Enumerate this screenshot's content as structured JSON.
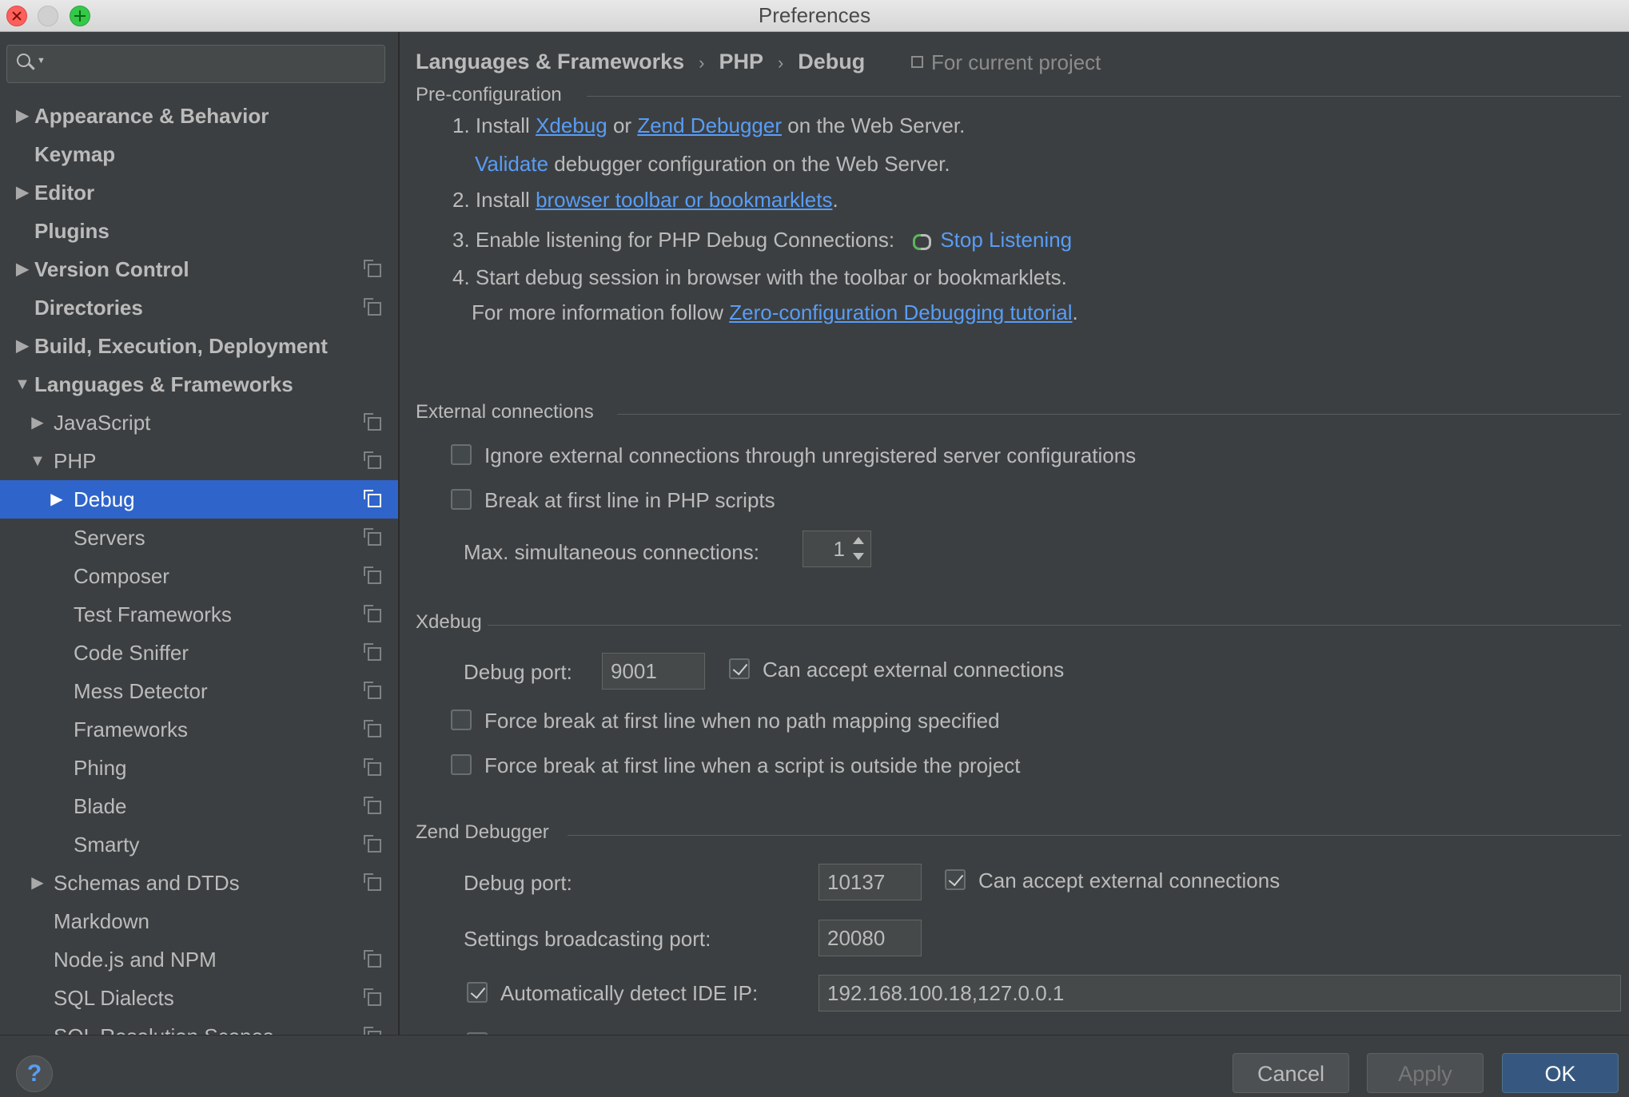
{
  "window": {
    "title": "Preferences"
  },
  "search": {
    "placeholder": ""
  },
  "sidebar": {
    "items": [
      {
        "label": "Appearance & Behavior"
      },
      {
        "label": "Keymap"
      },
      {
        "label": "Editor"
      },
      {
        "label": "Plugins"
      },
      {
        "label": "Version Control"
      },
      {
        "label": "Directories"
      },
      {
        "label": "Build, Execution, Deployment"
      },
      {
        "label": "Languages & Frameworks"
      },
      {
        "label": "JavaScript"
      },
      {
        "label": "PHP"
      },
      {
        "label": "Debug"
      },
      {
        "label": "Servers"
      },
      {
        "label": "Composer"
      },
      {
        "label": "Test Frameworks"
      },
      {
        "label": "Code Sniffer"
      },
      {
        "label": "Mess Detector"
      },
      {
        "label": "Frameworks"
      },
      {
        "label": "Phing"
      },
      {
        "label": "Blade"
      },
      {
        "label": "Smarty"
      },
      {
        "label": "Schemas and DTDs"
      },
      {
        "label": "Markdown"
      },
      {
        "label": "Node.js and NPM"
      },
      {
        "label": "SQL Dialects"
      },
      {
        "label": "SQL Resolution Scopes"
      }
    ]
  },
  "breadcrumb": {
    "items": [
      "Languages & Frameworks",
      "PHP",
      "Debug"
    ],
    "separator": "›",
    "scope_note": "For current project"
  },
  "preconfig": {
    "title": "Pre-configuration",
    "step1_prefix": "1. Install",
    "xdebug_link": "Xdebug",
    "or_text": "or",
    "zend_link": "Zend Debugger",
    "step1_suffix": "on the Web Server.",
    "validate_link": "Validate",
    "validate_suffix": "debugger configuration on the Web Server.",
    "step2_prefix": "2. Install",
    "toolbar_link": "browser toolbar or bookmarklets",
    "period": ".",
    "step3_text": "3. Enable listening for PHP Debug Connections:",
    "stop_listening": "Stop Listening",
    "step4_text": "4. Start debug session in browser with the toolbar or bookmarklets.",
    "more_info_prefix": "For more information follow",
    "tutorial_link": "Zero-configuration Debugging tutorial"
  },
  "external": {
    "title": "External connections",
    "ignore_label": "Ignore external connections through unregistered server configurations",
    "ignore_checked": false,
    "break_label": "Break at first line in PHP scripts",
    "break_checked": false,
    "max_label": "Max. simultaneous connections:",
    "max_value": "1"
  },
  "xdebug": {
    "title": "Xdebug",
    "port_label": "Debug port:",
    "port_value": "9001",
    "accept_label": "Can accept external connections",
    "accept_checked": true,
    "force_no_mapping_label": "Force break at first line when no path mapping specified",
    "force_outside_label": "Force break at first line when a script is outside the project"
  },
  "zend": {
    "title": "Zend Debugger",
    "port_label": "Debug port:",
    "port_value": "10137",
    "accept_label": "Can accept external connections",
    "accept_checked": true,
    "broadcast_label": "Settings broadcasting port:",
    "broadcast_value": "20080",
    "autodetect_label": "Automatically detect IDE IP:",
    "autodetect_checked": true,
    "ip_value": "192.168.100.18,127.0.0.1"
  },
  "footer": {
    "help": "?",
    "cancel": "Cancel",
    "apply": "Apply",
    "ok": "OK"
  },
  "colors": {
    "selection": "#2f65ca",
    "link": "#589df6",
    "background": "#3c3f41"
  }
}
